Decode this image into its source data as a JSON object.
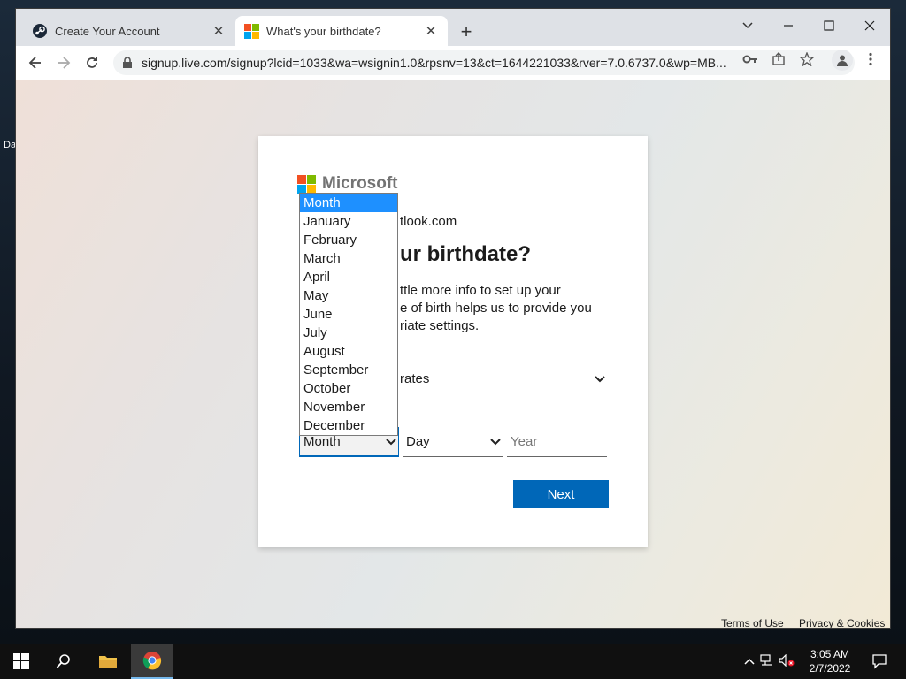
{
  "desktop": {
    "side_label": "Da"
  },
  "tabs": [
    {
      "title": "Create Your Account",
      "active": false
    },
    {
      "title": "What's your birthdate?",
      "active": true
    }
  ],
  "window_controls": {
    "tab_search": "⌄",
    "minimize": "—",
    "maximize": "☐",
    "close": "✕"
  },
  "toolbar": {
    "url": "signup.live.com/signup?lcid=1033&wa=wsignin1.0&rpsnv=13&ct=1644221033&rver=7.0.6737.0&wp=MB..."
  },
  "card": {
    "brand": "Microsoft",
    "email_fragment": "tlook.com",
    "heading_fragment": "ur birthdate?",
    "desc_lines": [
      "ttle more info to set up your",
      "e of birth helps us to provide you",
      "riate settings."
    ],
    "country_value": "rates",
    "month_value": "Month",
    "day_value": "Day",
    "year_placeholder": "Year",
    "next_label": "Next"
  },
  "month_dropdown": {
    "options": [
      "Month",
      "January",
      "February",
      "March",
      "April",
      "May",
      "June",
      "July",
      "August",
      "September",
      "October",
      "November",
      "December"
    ],
    "selected": "Month"
  },
  "footer": {
    "terms": "Terms of Use",
    "privacy": "Privacy & Cookies"
  },
  "taskbar": {
    "time": "3:05 AM",
    "date": "2/7/2022"
  },
  "colors": {
    "accent": "#0067b8",
    "dropdown_highlight": "#1e90ff",
    "ms_red": "#f25022",
    "ms_green": "#7fba00",
    "ms_blue": "#00a4ef",
    "ms_yellow": "#ffb900"
  }
}
